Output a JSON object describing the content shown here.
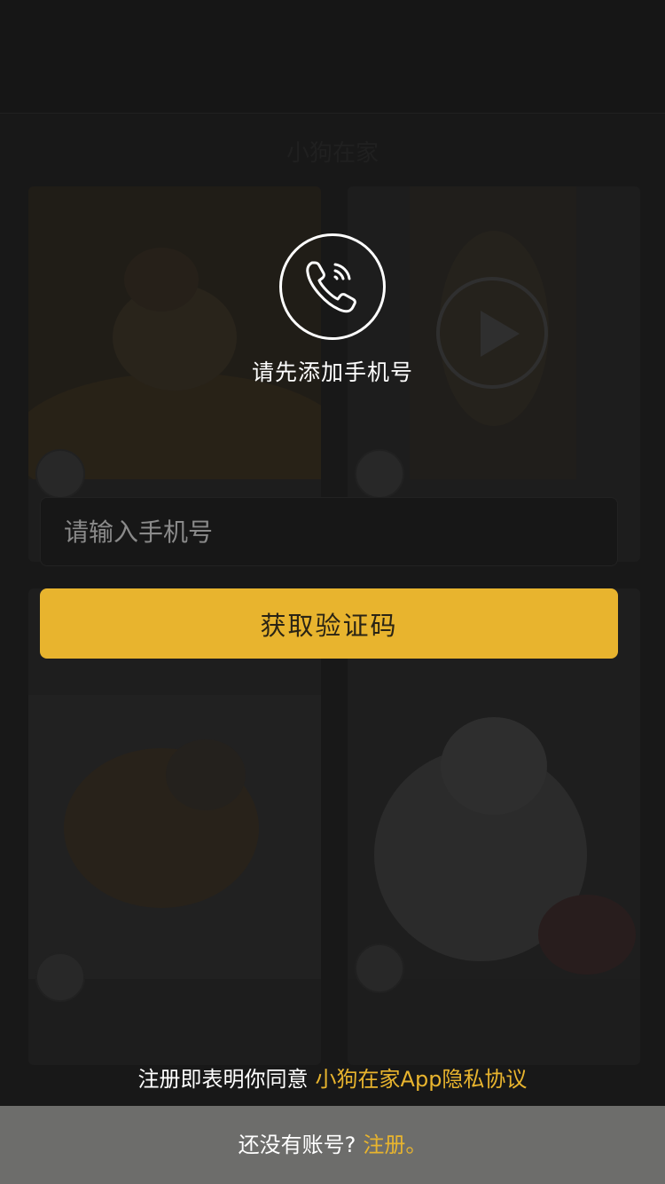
{
  "background": {
    "title": "小狗在家"
  },
  "dialog": {
    "icon": "phone-ringing-icon",
    "prompt": "请先添加手机号",
    "phone_input_placeholder": "请输入手机号",
    "get_code_label": "获取验证码"
  },
  "agreement": {
    "text": "注册即表明你同意",
    "link": "小狗在家App隐私协议"
  },
  "footer": {
    "text": "还没有账号?",
    "register_link": "注册。"
  },
  "colors": {
    "accent": "#e8b42e",
    "input_bg": "#171717",
    "footer_bg": "#6d6d6b"
  }
}
